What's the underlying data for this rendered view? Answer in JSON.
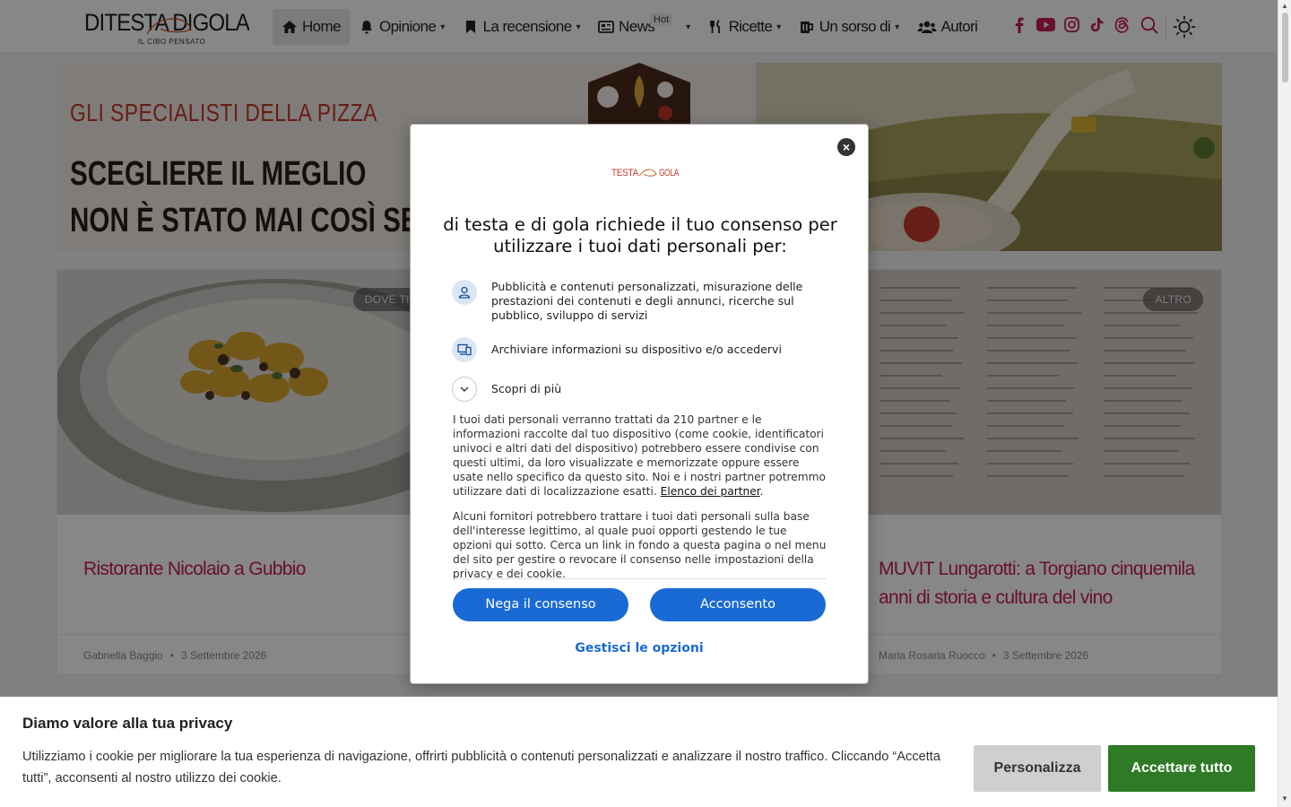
{
  "header": {
    "logo_text": "DI TESTA DI GOLA",
    "logo_tagline": "IL CIBO PENSATO",
    "nav": [
      {
        "label": "Home",
        "icon": "home-icon",
        "active": true
      },
      {
        "label": "Opinione",
        "icon": "bell-icon"
      },
      {
        "label": "La recensione",
        "icon": "bookmark-icon"
      },
      {
        "label": "News",
        "icon": "newspaper-icon",
        "badge": "Hot"
      },
      {
        "label": "Ricette",
        "icon": "utensils-icon"
      },
      {
        "label": "Un sorso di",
        "icon": "mug-icon"
      },
      {
        "label": "Autori",
        "icon": "users-icon"
      }
    ],
    "socials": [
      "facebook-icon",
      "youtube-icon",
      "instagram-icon",
      "tiktok-icon",
      "threads-icon"
    ],
    "accent_color": "#c41e5a"
  },
  "banner": {
    "kicker": "GLI SPECIALISTI DELLA PIZZA",
    "headline_1": "SCEGLIERE IL MEGLIO",
    "headline_2": "NON È STATO MAI COSÌ SEM"
  },
  "cards": [
    {
      "tag": "DOVE TI PORTO",
      "title": "Ristorante Nicolaio a Gubbio",
      "author": "Gabriella Baggio",
      "date": "3 Settembre 2026"
    },
    {
      "tag": "ALTRO",
      "title": "MUVIT Lungarotti: a Torgiano cinquemila anni di storia e cultura del vino",
      "author": "Maria Rosaria Ruocco",
      "date": "3 Settembre 2026"
    }
  ],
  "consent_modal": {
    "logo": "TESTA GOLA",
    "title": "di testa e di gola richiede il tuo consenso per utilizzare i tuoi dati personali per:",
    "purposes": [
      {
        "icon": "user-icon",
        "text": "Pubblicità e contenuti personalizzati, misurazione delle prestazioni dei contenuti e degli annunci, ricerche sul pubblico, sviluppo di servizi"
      },
      {
        "icon": "devices-icon",
        "text": "Archiviare informazioni su dispositivo e/o accedervi"
      },
      {
        "icon": "chevron-down-icon",
        "text": "Scopri di più"
      }
    ],
    "body_1": "I tuoi dati personali verranno trattati da 210 partner e le informazioni raccolte dal tuo dispositivo (come cookie, identificatori univoci e altri dati del dispositivo) potrebbero essere condivise con questi ultimi, da loro visualizzate e memorizzate oppure essere usate nello specifico da questo sito. Noi e i nostri partner potremmo utilizzare dati di localizzazione esatti.",
    "partners_link": "Elenco dei partner",
    "body_2": "Alcuni fornitori potrebbero trattare i tuoi dati personali sulla base dell'interesse legittimo, al quale puoi opporti gestendo le tue opzioni qui sotto. Cerca un link in fondo a questa pagina o nel menu del sito per gestire o revocare il consenso nelle impostazioni della privacy e dei cookie.",
    "deny_label": "Nega il consenso",
    "accept_label": "Acconsento",
    "manage_label": "Gestisci le opzioni",
    "button_color": "#1a6ad6"
  },
  "cookie_bar": {
    "title": "Diamo valore alla tua privacy",
    "text": "Utilizziamo i cookie per migliorare la tua esperienza di navigazione, offrirti pubblicità o contenuti personalizzati e analizzare il nostro traffico. Cliccando “Accetta tutti”, acconsenti al nostro utilizzo dei cookie.",
    "customize_label": "Personalizza",
    "accept_all_label": "Accettare tutto",
    "accept_color": "#2e7a25"
  }
}
